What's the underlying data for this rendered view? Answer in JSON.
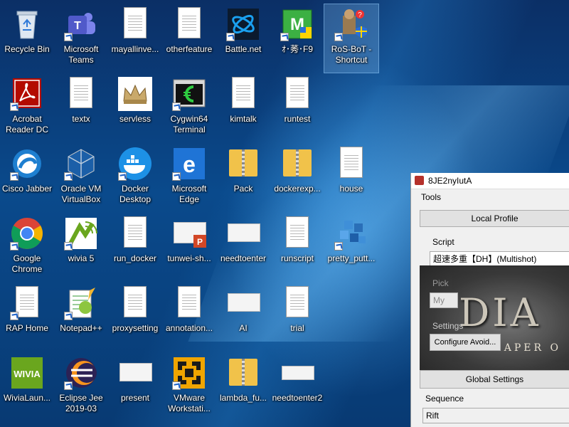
{
  "desktop": {
    "icons": [
      {
        "label": "Recycle Bin"
      },
      {
        "label": "Microsoft Teams"
      },
      {
        "label": "mayallinve..."
      },
      {
        "label": "otherfeature"
      },
      {
        "label": "Battle.net"
      },
      {
        "label": "ｵ･莠･F9"
      },
      {
        "label": "RoS-BoT - Shortcut"
      },
      {
        "label": "Acrobat Reader DC"
      },
      {
        "label": "textx"
      },
      {
        "label": "servless"
      },
      {
        "label": "Cygwin64 Terminal"
      },
      {
        "label": "kimtalk"
      },
      {
        "label": "runtest"
      },
      {
        "label": "Cisco Jabber"
      },
      {
        "label": "Oracle VM VirtualBox"
      },
      {
        "label": "Docker Desktop"
      },
      {
        "label": "Microsoft Edge"
      },
      {
        "label": "Pack"
      },
      {
        "label": "dockerexp..."
      },
      {
        "label": "house"
      },
      {
        "label": "Google Chrome"
      },
      {
        "label": "wivia 5"
      },
      {
        "label": "run_docker"
      },
      {
        "label": "tunwei-sh..."
      },
      {
        "label": "needtoenter"
      },
      {
        "label": "runscript"
      },
      {
        "label": "pretty_putt..."
      },
      {
        "label": "RAP Home"
      },
      {
        "label": "Notepad++"
      },
      {
        "label": "proxysetting"
      },
      {
        "label": "annotation..."
      },
      {
        "label": "AI"
      },
      {
        "label": "trial"
      },
      {
        "label": "WiviaLaun..."
      },
      {
        "label": "Eclipse Jee 2019-03"
      },
      {
        "label": "present"
      },
      {
        "label": "VMware Workstati..."
      },
      {
        "label": "lambda_fu..."
      },
      {
        "label": "needtoenter2"
      }
    ]
  },
  "app": {
    "title": "8JE2nyIutA",
    "menu_tools": "Tools",
    "local_profile_button": "Local Profile",
    "script_label": "Script",
    "script_value": "超速多重【DH】(Multishot)",
    "pick_label": "Pick",
    "pick_value": "My",
    "settings_label": "Settings",
    "configure_button": "Configure Avoid...",
    "art_title": "DIA",
    "art_subtitle": "REAPER O",
    "global_settings_button": "Global Settings",
    "sequence_label": "Sequence",
    "sequence_value": "Rift"
  }
}
